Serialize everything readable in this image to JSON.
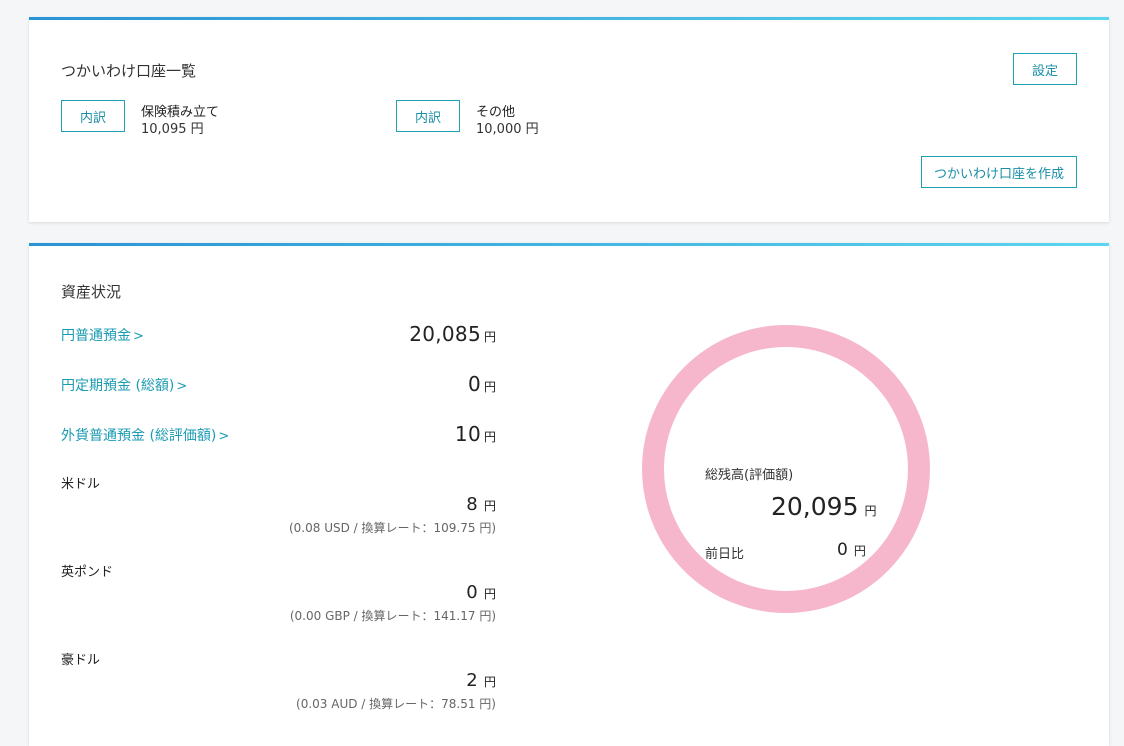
{
  "subaccounts": {
    "title": "つかいわけ口座一覧",
    "settings_label": "設定",
    "create_label": "つかいわけ口座を作成",
    "items": [
      {
        "button": "内訳",
        "name": "保険積み立て",
        "amount": "10,095 円"
      },
      {
        "button": "内訳",
        "name": "その他",
        "amount": "10,000 円"
      }
    ]
  },
  "assets": {
    "title": "資産状況",
    "rows": [
      {
        "label": "円普通預金",
        "chevron": ">",
        "value": "20,085",
        "unit": "円"
      },
      {
        "label": "円定期預金 (総額)",
        "chevron": ">",
        "value": "0",
        "unit": "円"
      },
      {
        "label": "外貨普通預金 (総評価額)",
        "chevron": ">",
        "value": "10",
        "unit": "円"
      }
    ],
    "currencies": [
      {
        "label": "米ドル",
        "value": "8",
        "unit": "円",
        "rate": "(0.08 USD / 換算レート：109.75 円)"
      },
      {
        "label": "英ポンド",
        "value": "0",
        "unit": "円",
        "rate": "(0.00 GBP / 換算レート：141.17 円)"
      },
      {
        "label": "豪ドル",
        "value": "2",
        "unit": "円",
        "rate": "(0.03 AUD / 換算レート：78.51 円)"
      }
    ]
  },
  "summary": {
    "total_label": "総残高(評価額)",
    "total_value": "20,095",
    "total_unit": "円",
    "prev_label": "前日比",
    "prev_value": "0",
    "prev_unit": "円",
    "ring_color": "#f6b7cd"
  },
  "colors": {
    "accent": "#1a9bb3",
    "header_gradient_start": "#2a93d5",
    "header_gradient_end": "#5ad6ee"
  }
}
